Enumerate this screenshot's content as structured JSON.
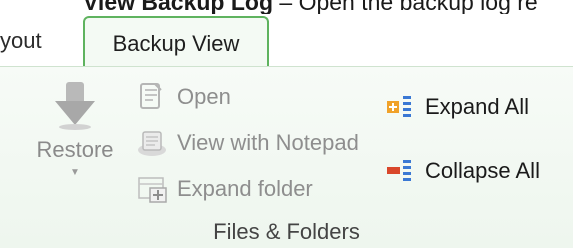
{
  "doc_line": {
    "bold": "View Backup Log",
    "rest": " – Open the backup log re"
  },
  "tabs": {
    "previous_label": "yout",
    "active_label": "Backup View"
  },
  "ribbon": {
    "restore": {
      "label": "Restore"
    },
    "open": {
      "label": "Open"
    },
    "view_notepad": {
      "label": "View with Notepad"
    },
    "expand_folder": {
      "label": "Expand folder"
    },
    "expand_all": {
      "label": "Expand All"
    },
    "collapse_all": {
      "label": "Collapse All"
    },
    "group_label": "Files & Folders"
  },
  "colors": {
    "accent_green": "#5fb35f",
    "expand_icon": "#f0a22a",
    "collapse_icon": "#d9472b",
    "list_blue": "#3a78d4"
  }
}
